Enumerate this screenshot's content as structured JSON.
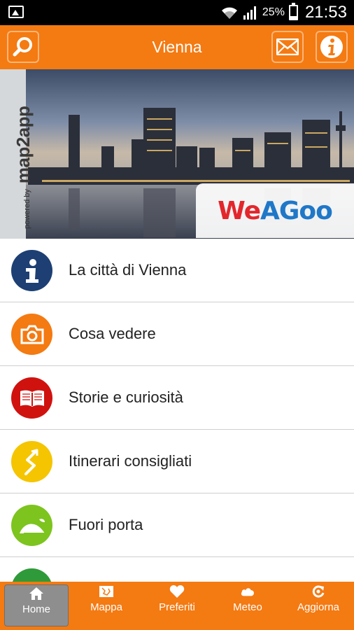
{
  "statusbar": {
    "battery": "25%",
    "time": "21:53"
  },
  "topbar": {
    "title": "Vienna"
  },
  "banner": {
    "powered_by": "powered by",
    "brand": "map2app",
    "logo": {
      "part1": "We",
      "part2": "AGoo"
    }
  },
  "menu": {
    "items": [
      {
        "label": "La città di Vienna",
        "icon": "info-icon",
        "color": "#1d3f73"
      },
      {
        "label": "Cosa vedere",
        "icon": "camera-icon",
        "color": "#f47a12"
      },
      {
        "label": "Storie e curiosità",
        "icon": "book-icon",
        "color": "#d0120f"
      },
      {
        "label": "Itinerari consigliati",
        "icon": "route-icon",
        "color": "#f4c500"
      },
      {
        "label": "Fuori porta",
        "icon": "hill-icon",
        "color": "#7dc41f"
      }
    ]
  },
  "bottomnav": {
    "items": [
      {
        "label": "Home",
        "icon": "home-icon",
        "active": true
      },
      {
        "label": "Mappa",
        "icon": "map-icon"
      },
      {
        "label": "Preferiti",
        "icon": "heart-icon"
      },
      {
        "label": "Meteo",
        "icon": "cloud-icon"
      },
      {
        "label": "Aggiorna",
        "icon": "refresh-icon"
      }
    ]
  },
  "colors": {
    "accent": "#f47a12",
    "status_bar": "#000000"
  }
}
